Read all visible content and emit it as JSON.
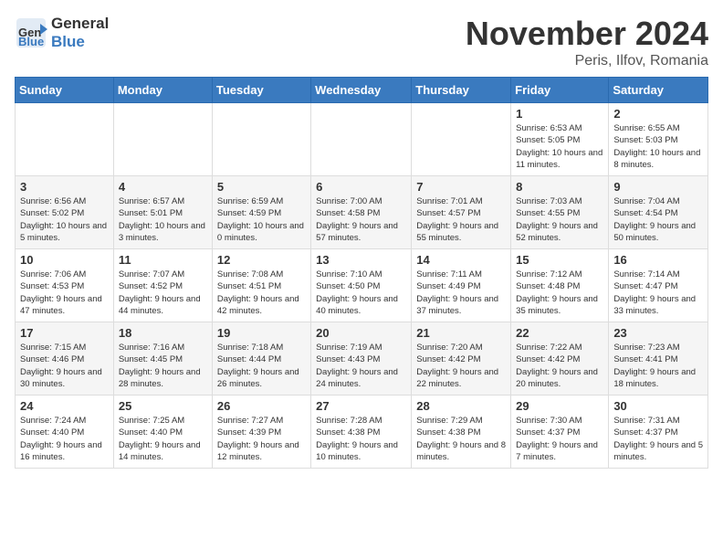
{
  "header": {
    "logo_general": "General",
    "logo_blue": "Blue",
    "month": "November 2024",
    "location": "Peris, Ilfov, Romania"
  },
  "days_of_week": [
    "Sunday",
    "Monday",
    "Tuesday",
    "Wednesday",
    "Thursday",
    "Friday",
    "Saturday"
  ],
  "weeks": [
    [
      {
        "num": "",
        "info": ""
      },
      {
        "num": "",
        "info": ""
      },
      {
        "num": "",
        "info": ""
      },
      {
        "num": "",
        "info": ""
      },
      {
        "num": "",
        "info": ""
      },
      {
        "num": "1",
        "info": "Sunrise: 6:53 AM\nSunset: 5:05 PM\nDaylight: 10 hours and 11 minutes."
      },
      {
        "num": "2",
        "info": "Sunrise: 6:55 AM\nSunset: 5:03 PM\nDaylight: 10 hours and 8 minutes."
      }
    ],
    [
      {
        "num": "3",
        "info": "Sunrise: 6:56 AM\nSunset: 5:02 PM\nDaylight: 10 hours and 5 minutes."
      },
      {
        "num": "4",
        "info": "Sunrise: 6:57 AM\nSunset: 5:01 PM\nDaylight: 10 hours and 3 minutes."
      },
      {
        "num": "5",
        "info": "Sunrise: 6:59 AM\nSunset: 4:59 PM\nDaylight: 10 hours and 0 minutes."
      },
      {
        "num": "6",
        "info": "Sunrise: 7:00 AM\nSunset: 4:58 PM\nDaylight: 9 hours and 57 minutes."
      },
      {
        "num": "7",
        "info": "Sunrise: 7:01 AM\nSunset: 4:57 PM\nDaylight: 9 hours and 55 minutes."
      },
      {
        "num": "8",
        "info": "Sunrise: 7:03 AM\nSunset: 4:55 PM\nDaylight: 9 hours and 52 minutes."
      },
      {
        "num": "9",
        "info": "Sunrise: 7:04 AM\nSunset: 4:54 PM\nDaylight: 9 hours and 50 minutes."
      }
    ],
    [
      {
        "num": "10",
        "info": "Sunrise: 7:06 AM\nSunset: 4:53 PM\nDaylight: 9 hours and 47 minutes."
      },
      {
        "num": "11",
        "info": "Sunrise: 7:07 AM\nSunset: 4:52 PM\nDaylight: 9 hours and 44 minutes."
      },
      {
        "num": "12",
        "info": "Sunrise: 7:08 AM\nSunset: 4:51 PM\nDaylight: 9 hours and 42 minutes."
      },
      {
        "num": "13",
        "info": "Sunrise: 7:10 AM\nSunset: 4:50 PM\nDaylight: 9 hours and 40 minutes."
      },
      {
        "num": "14",
        "info": "Sunrise: 7:11 AM\nSunset: 4:49 PM\nDaylight: 9 hours and 37 minutes."
      },
      {
        "num": "15",
        "info": "Sunrise: 7:12 AM\nSunset: 4:48 PM\nDaylight: 9 hours and 35 minutes."
      },
      {
        "num": "16",
        "info": "Sunrise: 7:14 AM\nSunset: 4:47 PM\nDaylight: 9 hours and 33 minutes."
      }
    ],
    [
      {
        "num": "17",
        "info": "Sunrise: 7:15 AM\nSunset: 4:46 PM\nDaylight: 9 hours and 30 minutes."
      },
      {
        "num": "18",
        "info": "Sunrise: 7:16 AM\nSunset: 4:45 PM\nDaylight: 9 hours and 28 minutes."
      },
      {
        "num": "19",
        "info": "Sunrise: 7:18 AM\nSunset: 4:44 PM\nDaylight: 9 hours and 26 minutes."
      },
      {
        "num": "20",
        "info": "Sunrise: 7:19 AM\nSunset: 4:43 PM\nDaylight: 9 hours and 24 minutes."
      },
      {
        "num": "21",
        "info": "Sunrise: 7:20 AM\nSunset: 4:42 PM\nDaylight: 9 hours and 22 minutes."
      },
      {
        "num": "22",
        "info": "Sunrise: 7:22 AM\nSunset: 4:42 PM\nDaylight: 9 hours and 20 minutes."
      },
      {
        "num": "23",
        "info": "Sunrise: 7:23 AM\nSunset: 4:41 PM\nDaylight: 9 hours and 18 minutes."
      }
    ],
    [
      {
        "num": "24",
        "info": "Sunrise: 7:24 AM\nSunset: 4:40 PM\nDaylight: 9 hours and 16 minutes."
      },
      {
        "num": "25",
        "info": "Sunrise: 7:25 AM\nSunset: 4:40 PM\nDaylight: 9 hours and 14 minutes."
      },
      {
        "num": "26",
        "info": "Sunrise: 7:27 AM\nSunset: 4:39 PM\nDaylight: 9 hours and 12 minutes."
      },
      {
        "num": "27",
        "info": "Sunrise: 7:28 AM\nSunset: 4:38 PM\nDaylight: 9 hours and 10 minutes."
      },
      {
        "num": "28",
        "info": "Sunrise: 7:29 AM\nSunset: 4:38 PM\nDaylight: 9 hours and 8 minutes."
      },
      {
        "num": "29",
        "info": "Sunrise: 7:30 AM\nSunset: 4:37 PM\nDaylight: 9 hours and 7 minutes."
      },
      {
        "num": "30",
        "info": "Sunrise: 7:31 AM\nSunset: 4:37 PM\nDaylight: 9 hours and 5 minutes."
      }
    ]
  ]
}
